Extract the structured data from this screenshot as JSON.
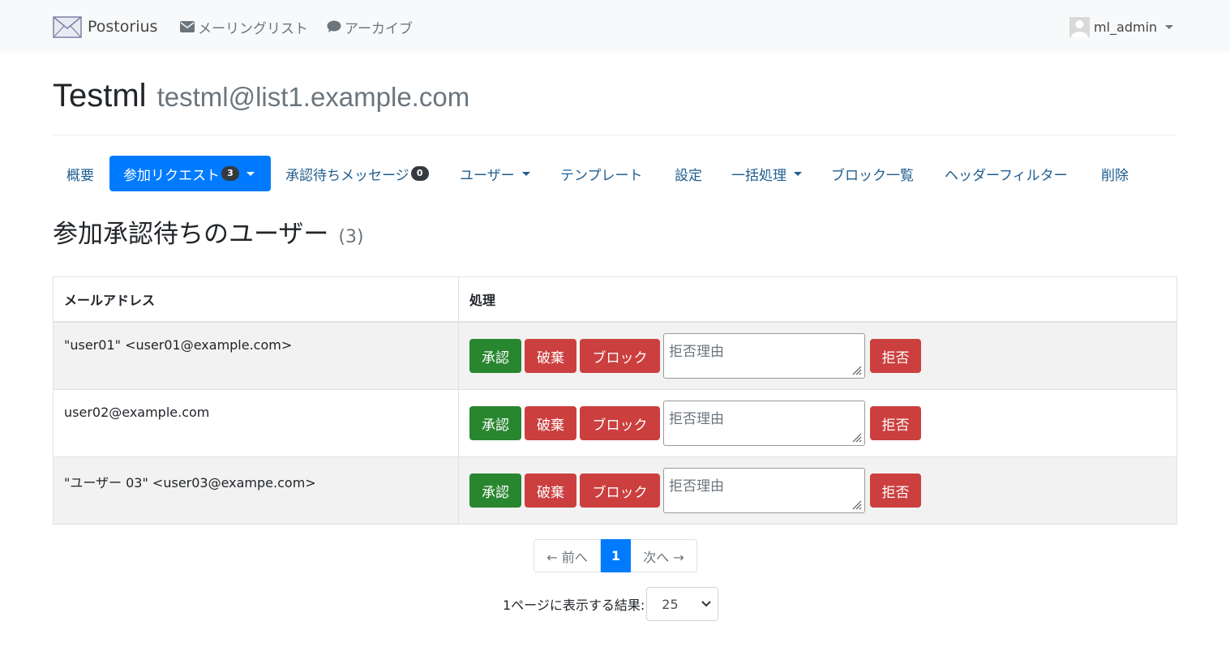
{
  "navbar": {
    "brand": "Postorius",
    "links": {
      "mailing_lists": "メーリングリスト",
      "archives": "アーカイブ"
    },
    "user": "ml_admin"
  },
  "list": {
    "name": "Testml",
    "address": "testml@list1.example.com"
  },
  "tabs": {
    "overview": "概要",
    "subscription_requests": "参加リクエスト",
    "subscription_requests_count": "3",
    "held_messages": "承認待ちメッセージ",
    "held_messages_count": "0",
    "users": "ユーザー",
    "templates": "テンプレート",
    "settings": "設定",
    "mass_ops": "一括処理",
    "ban_list": "ブロック一覧",
    "header_filters": "ヘッダーフィルター",
    "delete": "削除"
  },
  "heading": {
    "text": "参加承認待ちのユーザー",
    "count": "(3)"
  },
  "table": {
    "headers": {
      "email": "メールアドレス",
      "actions": "処理"
    },
    "rows": [
      {
        "email": "\"user01\" <user01@example.com>"
      },
      {
        "email": "user02@example.com"
      },
      {
        "email": "\"ユーザー 03\" <user03@exampe.com>"
      }
    ],
    "buttons": {
      "approve": "承認",
      "discard": "破棄",
      "ban": "ブロック",
      "reject": "拒否"
    },
    "reason_placeholder": "拒否理由"
  },
  "pagination": {
    "prev": "← 前へ",
    "current": "1",
    "next": "次へ →"
  },
  "per_page": {
    "label": "1ページに表示する結果:",
    "value": "25"
  },
  "colors": {
    "primary": "#007bff",
    "success": "#28862f",
    "danger": "#cc3f3f",
    "navbar_bg": "#f8f9fa"
  }
}
